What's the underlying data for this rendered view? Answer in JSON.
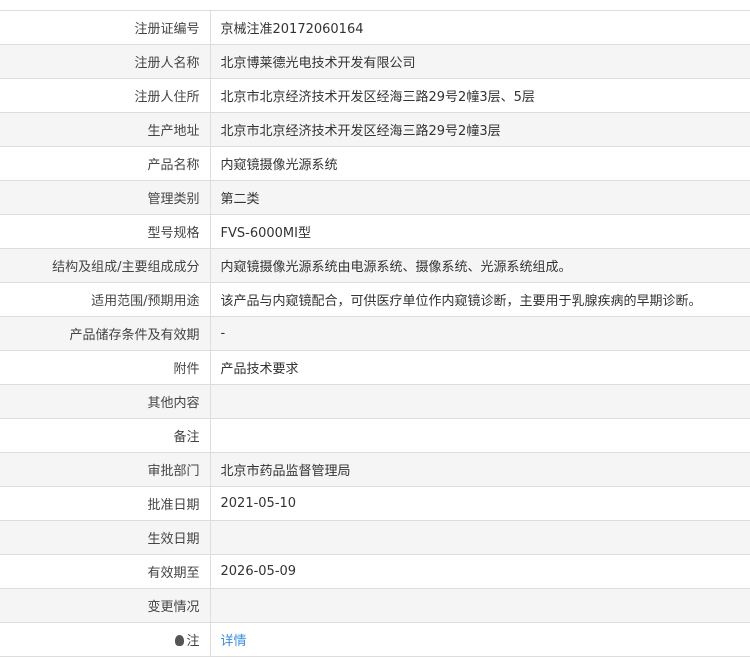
{
  "rows": [
    {
      "label": "注册证编号",
      "value": "京械注准20172060164"
    },
    {
      "label": "注册人名称",
      "value": "北京博莱德光电技术开发有限公司"
    },
    {
      "label": "注册人住所",
      "value": "北京市北京经济技术开发区经海三路29号2幢3层、5层"
    },
    {
      "label": "生产地址",
      "value": "北京市北京经济技术开发区经海三路29号2幢3层"
    },
    {
      "label": "产品名称",
      "value": "内窥镜摄像光源系统"
    },
    {
      "label": "管理类别",
      "value": "第二类"
    },
    {
      "label": "型号规格",
      "value": "FVS-6000MI型"
    },
    {
      "label": "结构及组成/主要组成成分",
      "value": "内窥镜摄像光源系统由电源系统、摄像系统、光源系统组成。"
    },
    {
      "label": "适用范围/预期用途",
      "value": "该产品与内窥镜配合，可供医疗单位作内窥镜诊断，主要用于乳腺疾病的早期诊断。"
    },
    {
      "label": "产品储存条件及有效期",
      "value": "-"
    },
    {
      "label": "附件",
      "value": "产品技术要求"
    },
    {
      "label": "其他内容",
      "value": ""
    },
    {
      "label": "备注",
      "value": ""
    },
    {
      "label": "审批部门",
      "value": "北京市药品监督管理局"
    },
    {
      "label": "批准日期",
      "value": "2021-05-10"
    },
    {
      "label": "生效日期",
      "value": ""
    },
    {
      "label": "有效期至",
      "value": "2026-05-09"
    },
    {
      "label": "变更情况",
      "value": ""
    }
  ],
  "note": {
    "label": "注",
    "link": "详情",
    "icon": "lightbulb-icon"
  }
}
